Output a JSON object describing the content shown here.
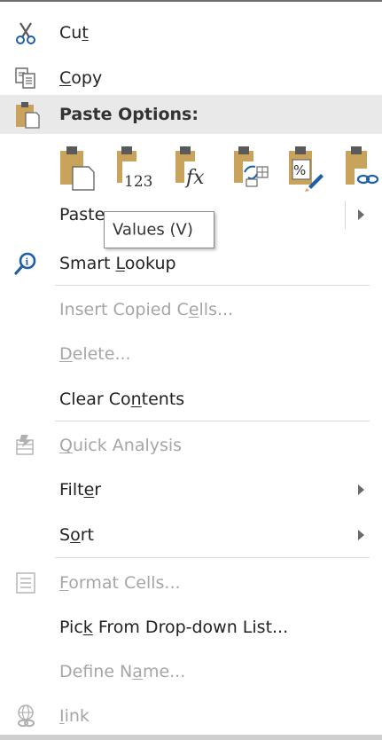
{
  "colors": {
    "menu_bg": "#ffffff",
    "paste_header_bg": "#e9e9e9",
    "disabled_text": "#a6a6a6",
    "clipboard_tan": "#c9a25c",
    "lookup_blue": "#1e5fa8"
  },
  "menu": {
    "cut": {
      "icon": "scissors-icon",
      "parts": [
        "Cu",
        "t",
        ""
      ]
    },
    "copy": {
      "icon": "copy-icon",
      "parts": [
        "",
        "C",
        "opy"
      ]
    },
    "paste_options": {
      "icon": "clipboard-icon",
      "label": "Paste Options:"
    },
    "paste_special": {
      "label": "Paste"
    },
    "smart_lookup": {
      "icon": "smart-lookup-icon",
      "parts": [
        "Smart ",
        "L",
        "ookup"
      ]
    },
    "insert_copied": {
      "parts": [
        "Insert Copied C",
        "e",
        "lls..."
      ]
    },
    "delete": {
      "parts": [
        "",
        "D",
        "elete..."
      ]
    },
    "clear_contents": {
      "parts": [
        "Clear Co",
        "n",
        "tents"
      ]
    },
    "quick_analysis": {
      "icon": "quick-analysis-icon",
      "parts": [
        "",
        "Q",
        "uick Analysis"
      ]
    },
    "filter": {
      "parts": [
        "Filt",
        "e",
        "r"
      ]
    },
    "sort": {
      "parts": [
        "S",
        "o",
        "rt"
      ]
    },
    "format_cells": {
      "icon": "format-cells-icon",
      "parts": [
        "",
        "F",
        "ormat Cells..."
      ]
    },
    "pick_list": {
      "parts": [
        "Pic",
        "k",
        " From Drop-down List..."
      ]
    },
    "define_name": {
      "parts": [
        "Define N",
        "a",
        "me..."
      ]
    },
    "link": {
      "icon": "link-icon",
      "parts": [
        "",
        "I",
        "ink"
      ]
    }
  },
  "paste_buttons": [
    {
      "name": "paste",
      "icon": "paste-icon"
    },
    {
      "name": "values",
      "icon": "paste-values-icon",
      "text": "123"
    },
    {
      "name": "formulas",
      "icon": "paste-formulas-icon",
      "text": "fx"
    },
    {
      "name": "transpose",
      "icon": "paste-transpose-icon"
    },
    {
      "name": "formatting",
      "icon": "paste-formatting-icon",
      "text": "%"
    },
    {
      "name": "link",
      "icon": "paste-link-icon"
    }
  ],
  "tooltip": {
    "text": "Values (V)"
  }
}
